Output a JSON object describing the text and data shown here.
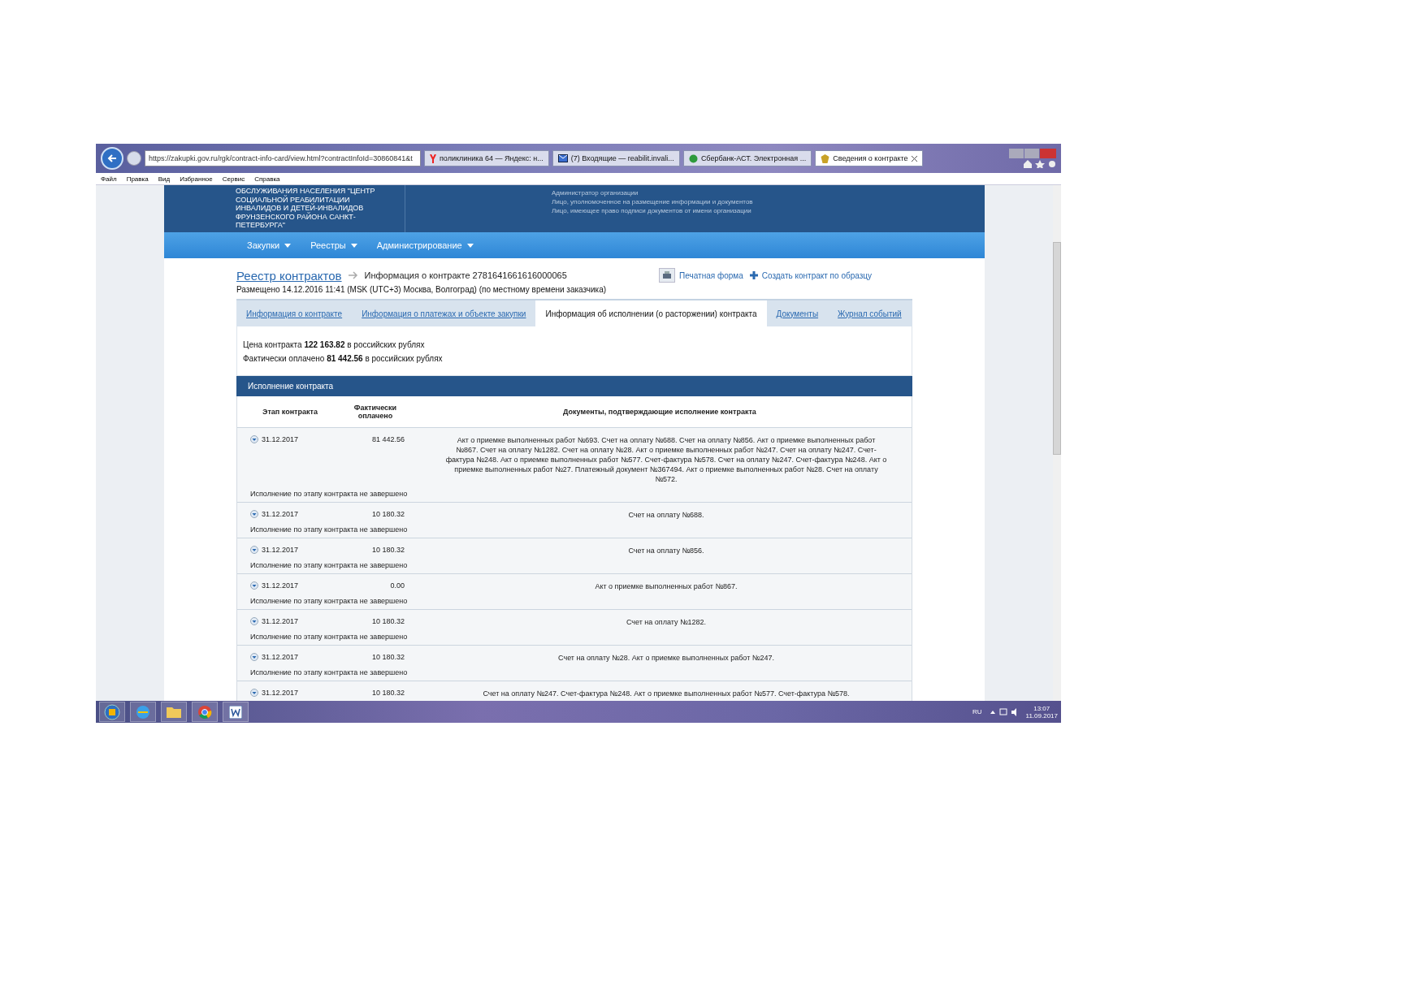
{
  "browser": {
    "address": "https://zakupki.gov.ru/rgk/contract-info-card/view.html?contractInfoId=30860841&t",
    "tabs": [
      {
        "title": "поликлиника 64 — Яндекс: н...",
        "selected": false
      },
      {
        "title": "(7) Входящие — reabilit.invali...",
        "selected": false
      },
      {
        "title": "Сбербанк-АСТ. Электронная ...",
        "selected": false
      },
      {
        "title": "Сведения о контракте",
        "selected": true
      }
    ],
    "menu": [
      "Файл",
      "Правка",
      "Вид",
      "Избранное",
      "Сервис",
      "Справка"
    ]
  },
  "header": {
    "organization": "ОБСЛУЖИВАНИЯ НАСЕЛЕНИЯ \"ЦЕНТР СОЦИАЛЬНОЙ РЕАБИЛИТАЦИИ ИНВАЛИДОВ И ДЕТЕЙ-ИНВАЛИДОВ ФРУНЗЕНСКОГО РАЙОНА САНКТ-ПЕТЕРБУРГА\"",
    "roles": [
      "Администратор организации",
      "Лицо, уполномоченное на размещение информации и документов",
      "Лицо, имеющее право подписи документов от имени организации"
    ]
  },
  "nav": [
    "Закупки",
    "Реестры",
    "Администрирование"
  ],
  "breadcrumb": {
    "root": "Реестр контрактов",
    "current": "Информация о контракте 2781641661616000065"
  },
  "actions": [
    {
      "kind": "print",
      "label": "Печатная форма"
    },
    {
      "kind": "create",
      "label": "Создать контракт по образцу"
    }
  ],
  "posted": "Размещено 14.12.2016 11:41 (MSK (UTC+3) Москва, Волгоград) (по местному времени заказчика)",
  "tabs": [
    {
      "label": "Информация о контракте",
      "selected": false
    },
    {
      "label": "Информация о платежах и объекте закупки",
      "selected": false
    },
    {
      "label": "Информация об исполнении (о расторжении) контракта",
      "selected": true
    },
    {
      "label": "Документы",
      "selected": false
    },
    {
      "label": "Журнал событий",
      "selected": false
    }
  ],
  "summary": [
    "Цена контракта **122 163.82** в российских рублях",
    "Фактически оплачено **81 442.56** в российских рублях"
  ],
  "section": {
    "title": "Исполнение контракта",
    "columns": [
      "Этап контракта",
      "Фактически оплачено",
      "Документы, подтверждающие исполнение контракта"
    ],
    "rows": [
      {
        "stage": "31.12.2017",
        "paid": "81 442.56",
        "documents": "Акт о приемке выполненных работ №693. Счет на оплату №688. Счет на оплату №856. Акт о приемке выполненных работ №867. Счет на оплату №1282. Счет на оплату №28. Акт о приемке выполненных работ №247. Счет на оплату №247. Счет-фактура №248. Акт о приемке выполненных работ №577. Счет-фактура №578. Счет на оплату №247. Счет-фактура №248. Акт о приемке выполненных работ №27. Платежный документ №367494. Акт о приемке выполненных работ №28. Счет на оплату №572.",
        "status": "Исполнение по этапу контракта не завершено"
      },
      {
        "stage": "31.12.2017",
        "paid": "10 180.32",
        "documents": "Счет на оплату №688.",
        "status": "Исполнение по этапу контракта не завершено"
      },
      {
        "stage": "31.12.2017",
        "paid": "10 180.32",
        "documents": "Счет на оплату №856.",
        "status": "Исполнение по этапу контракта не завершено"
      },
      {
        "stage": "31.12.2017",
        "paid": "0.00",
        "documents": "Акт о приемке выполненных работ №867.",
        "status": "Исполнение по этапу контракта не завершено"
      },
      {
        "stage": "31.12.2017",
        "paid": "10 180.32",
        "documents": "Счет на оплату №1282.",
        "status": "Исполнение по этапу контракта не завершено"
      },
      {
        "stage": "31.12.2017",
        "paid": "10 180.32",
        "documents": "Счет на оплату №28. Акт о приемке выполненных работ №247.",
        "status": "Исполнение по этапу контракта не завершено"
      },
      {
        "stage": "31.12.2017",
        "paid": "10 180.32",
        "documents": "Счет на оплату №247. Счет-фактура №248. Акт о приемке выполненных работ №577. Счет-фактура №578."
      }
    ]
  },
  "taskbar": {
    "language": "RU",
    "time": "13:07",
    "date": "11.09.2017"
  }
}
